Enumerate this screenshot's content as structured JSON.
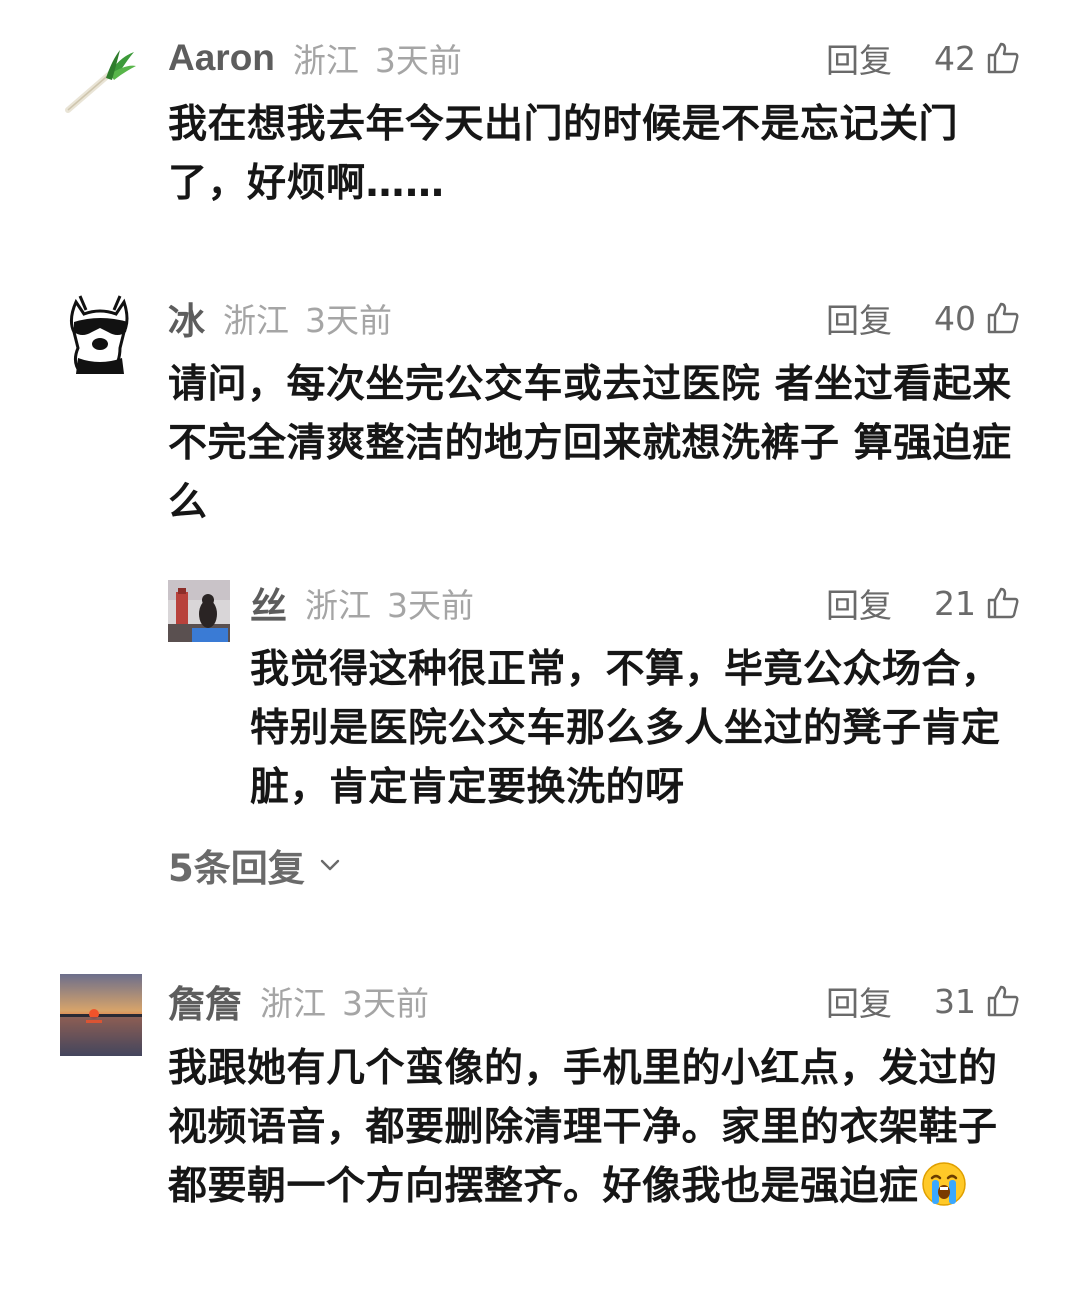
{
  "comments": [
    {
      "username": "Aaron",
      "region": "浙江",
      "time": "3天前",
      "reply_label": "回复",
      "likes": "42",
      "text": "我在想我去年今天出门的时候是不是忘记关门了，好烦啊……",
      "avatar_icon": "green-onion-icon"
    },
    {
      "username": "冰",
      "region": "浙江",
      "time": "3天前",
      "reply_label": "回复",
      "likes": "40",
      "text": "请问，每次坐完公交车或去过医院 者坐过看起来不完全清爽整洁的地方回来就想洗裤子 算强迫症么",
      "avatar_icon": "sunglasses-dog-icon",
      "replies": [
        {
          "username": "丝",
          "region": "浙江",
          "time": "3天前",
          "reply_label": "回复",
          "likes": "21",
          "text": "我觉得这种很正常，不算，毕竟公众场合，特别是医院公交车那么多人坐过的凳子肯定脏，肯定肯定要换洗的呀",
          "avatar_icon": "photo-avatar-icon"
        }
      ],
      "more_replies_label": "5条回复"
    },
    {
      "username": "詹詹",
      "region": "浙江",
      "time": "3天前",
      "reply_label": "回复",
      "likes": "31",
      "text": "我跟她有几个蛮像的，手机里的小红点，发过的视频语音，都要删除清理干净。家里的衣架鞋子都要朝一个方向摆整齐。好像我也是强迫症",
      "avatar_icon": "sunset-avatar-icon",
      "trailing_emoji": "crying-face-emoji"
    }
  ],
  "colors": {
    "username": "#5d5d5d",
    "meta": "#a5a5a5",
    "action": "#6a6a6a",
    "text": "#161616"
  }
}
